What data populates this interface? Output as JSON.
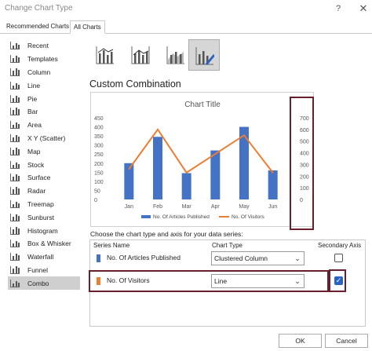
{
  "window": {
    "title": "Change Chart Type",
    "help": "?",
    "close": "✕"
  },
  "tabs": [
    "Recommended Charts",
    "All Charts"
  ],
  "sidebar": {
    "items": [
      {
        "label": "Recent",
        "icon": "recent-icon"
      },
      {
        "label": "Templates",
        "icon": "templates-icon"
      },
      {
        "label": "Column",
        "icon": "column-chart-icon"
      },
      {
        "label": "Line",
        "icon": "line-chart-icon"
      },
      {
        "label": "Pie",
        "icon": "pie-chart-icon"
      },
      {
        "label": "Bar",
        "icon": "bar-chart-icon"
      },
      {
        "label": "Area",
        "icon": "area-chart-icon"
      },
      {
        "label": "X Y (Scatter)",
        "icon": "scatter-chart-icon"
      },
      {
        "label": "Map",
        "icon": "map-chart-icon"
      },
      {
        "label": "Stock",
        "icon": "stock-chart-icon"
      },
      {
        "label": "Surface",
        "icon": "surface-chart-icon"
      },
      {
        "label": "Radar",
        "icon": "radar-chart-icon"
      },
      {
        "label": "Treemap",
        "icon": "treemap-chart-icon"
      },
      {
        "label": "Sunburst",
        "icon": "sunburst-chart-icon"
      },
      {
        "label": "Histogram",
        "icon": "histogram-chart-icon"
      },
      {
        "label": "Box & Whisker",
        "icon": "box-whisker-chart-icon"
      },
      {
        "label": "Waterfall",
        "icon": "waterfall-chart-icon"
      },
      {
        "label": "Funnel",
        "icon": "funnel-chart-icon"
      },
      {
        "label": "Combo",
        "icon": "combo-chart-icon"
      }
    ],
    "selected": "Combo"
  },
  "section_title": "Custom Combination",
  "chart_data": {
    "type": "bar",
    "title": "Chart Title",
    "categories": [
      "Jan",
      "Feb",
      "Mar",
      "Apr",
      "May",
      "Jun"
    ],
    "series": [
      {
        "name": "No. Of Articles Published",
        "kind": "bar",
        "axis": "primary",
        "color": "#4472c4",
        "values": [
          200,
          345,
          145,
          270,
          400,
          160
        ]
      },
      {
        "name": "No. Of Visitors",
        "kind": "line",
        "axis": "secondary",
        "color": "#ed7d31",
        "values": [
          260,
          600,
          230,
          390,
          550,
          230
        ]
      }
    ],
    "y_ticks": [
      "450",
      "400",
      "350",
      "300",
      "250",
      "200",
      "150",
      "100",
      "50",
      "0"
    ],
    "y2_ticks": [
      "700",
      "600",
      "500",
      "400",
      "300",
      "200",
      "100",
      "0"
    ],
    "ylim": [
      0,
      450
    ],
    "y2lim": [
      0,
      700
    ],
    "legend": "bottom"
  },
  "series_prompt": "Choose the chart type and axis for your data series:",
  "grid_headers": {
    "name": "Series Name",
    "type": "Chart Type",
    "secondary": "Secondary Axis"
  },
  "rows": [
    {
      "name": "No. Of Articles Published",
      "color": "#4472c4",
      "chart_type": "Clustered Column",
      "secondary": false
    },
    {
      "name": "No. Of Visitors",
      "color": "#ed7d31",
      "chart_type": "Line",
      "secondary": true
    }
  ],
  "buttons": {
    "ok": "OK",
    "cancel": "Cancel"
  },
  "colors": {
    "accent": "#2a63c5",
    "highlight": "#6b1e2b"
  }
}
